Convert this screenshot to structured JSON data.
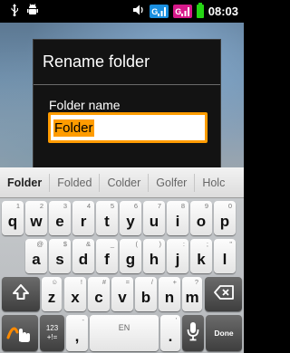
{
  "status_bar": {
    "icons": [
      "usb-icon",
      "android-debug-icon",
      "volume-icon",
      "network-3g-icon",
      "network-3g-alt-icon",
      "battery-icon"
    ],
    "network_1_label": "G",
    "network_2_label": "G",
    "time": "08:03",
    "colors": {
      "network_1": "#1a8fe0",
      "network_2": "#d6198a",
      "battery": "#25d414"
    }
  },
  "dialog": {
    "title": "Rename folder",
    "field_label": "Folder name",
    "field_value": "Folder",
    "accent_color": "#ff9c00"
  },
  "keyboard": {
    "suggestions": [
      "Folder",
      "Folded",
      "Colder",
      "Golfer",
      "Holc"
    ],
    "row1": [
      {
        "label": "q",
        "hint": "1"
      },
      {
        "label": "w",
        "hint": "2"
      },
      {
        "label": "e",
        "hint": "3"
      },
      {
        "label": "r",
        "hint": "4"
      },
      {
        "label": "t",
        "hint": "5"
      },
      {
        "label": "y",
        "hint": "6"
      },
      {
        "label": "u",
        "hint": "7"
      },
      {
        "label": "i",
        "hint": "8"
      },
      {
        "label": "o",
        "hint": "9"
      },
      {
        "label": "p",
        "hint": "0"
      }
    ],
    "row2": [
      {
        "label": "a",
        "hint": "@"
      },
      {
        "label": "s",
        "hint": "$"
      },
      {
        "label": "d",
        "hint": "&"
      },
      {
        "label": "f",
        "hint": "_"
      },
      {
        "label": "g",
        "hint": "("
      },
      {
        "label": "h",
        "hint": ")"
      },
      {
        "label": "j",
        "hint": ":"
      },
      {
        "label": "k",
        "hint": ";"
      },
      {
        "label": "l",
        "hint": "\""
      }
    ],
    "row3": [
      {
        "label": "z",
        "hint": "☺"
      },
      {
        "label": "x",
        "hint": "!"
      },
      {
        "label": "c",
        "hint": "#"
      },
      {
        "label": "v",
        "hint": "="
      },
      {
        "label": "b",
        "hint": "/"
      },
      {
        "label": "n",
        "hint": "+"
      },
      {
        "label": "m",
        "hint": "?"
      }
    ],
    "bottom": {
      "symbols_label_1": "123",
      "symbols_label_2": "+!=",
      "comma_label": ",",
      "comma_hint": "-",
      "space_label": "EN",
      "period_label": ".",
      "period_hint": "'",
      "done_label": "Done"
    }
  }
}
